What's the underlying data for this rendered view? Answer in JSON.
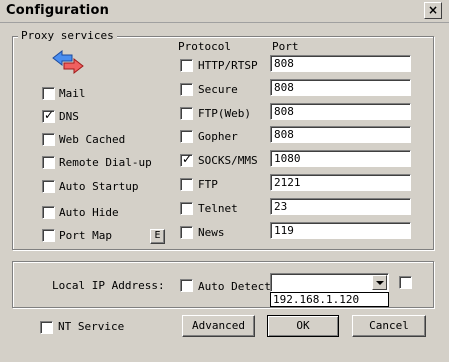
{
  "window": {
    "title": "Configuration",
    "close_glyph": "×"
  },
  "proxy_group": {
    "legend": "Proxy services",
    "protocol_header": "Protocol",
    "port_header": "Port",
    "icon": "arrows-icon"
  },
  "left_options": [
    {
      "label": "Mail",
      "checked": false
    },
    {
      "label": "DNS",
      "checked": true
    },
    {
      "label": "Web Cached",
      "checked": false
    },
    {
      "label": "Remote Dial-up",
      "checked": false
    },
    {
      "label": "Auto Startup",
      "checked": false
    },
    {
      "label": "Auto Hide",
      "checked": false
    },
    {
      "label": "Port Map",
      "checked": false
    }
  ],
  "port_map_button": "E",
  "protocols": [
    {
      "label": "HTTP/RTSP",
      "checked": false,
      "port": "808"
    },
    {
      "label": "Secure",
      "checked": false,
      "port": "808"
    },
    {
      "label": "FTP(Web)",
      "checked": false,
      "port": "808"
    },
    {
      "label": "Gopher",
      "checked": false,
      "port": "808"
    },
    {
      "label": "SOCKS/MMS",
      "checked": true,
      "port": "1080"
    },
    {
      "label": "FTP",
      "checked": false,
      "port": "2121"
    },
    {
      "label": "Telnet",
      "checked": false,
      "port": "23"
    },
    {
      "label": "News",
      "checked": false,
      "port": "119"
    }
  ],
  "local_ip": {
    "label": "Local IP Address:",
    "auto_detect_label": "Auto Detect",
    "auto_detect_checked": false,
    "value": "",
    "dropdown_option": "192.168.1.120",
    "extra_checked": false
  },
  "bottom": {
    "nt_service_label": "NT Service",
    "nt_service_checked": false,
    "advanced": "Advanced",
    "ok": "OK",
    "cancel": "Cancel"
  }
}
